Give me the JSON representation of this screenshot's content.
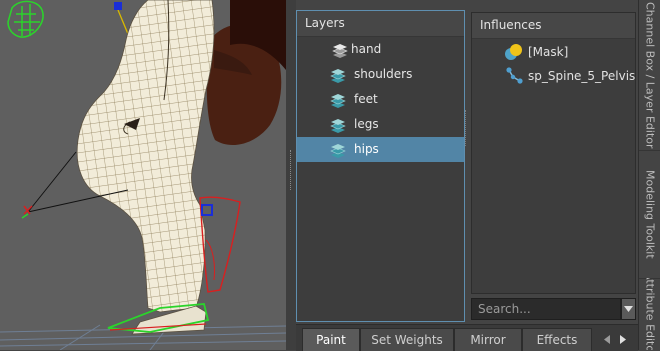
{
  "layers_panel": {
    "title": "Layers",
    "items": [
      {
        "label": "hand",
        "selected": false,
        "icon": "layer-stack-grey-icon"
      },
      {
        "label": "shoulders",
        "selected": false,
        "icon": "layer-stack-teal-icon"
      },
      {
        "label": "feet",
        "selected": false,
        "icon": "layer-stack-teal-icon"
      },
      {
        "label": "legs",
        "selected": false,
        "icon": "layer-stack-teal-icon"
      },
      {
        "label": "hips",
        "selected": true,
        "icon": "layer-stack-teal-icon"
      }
    ]
  },
  "influences_panel": {
    "title": "Influences",
    "items": [
      {
        "label": "[Mask]",
        "icon": "mask-icon"
      },
      {
        "label": "sp_Spine_5_Pelvis",
        "icon": "joint-icon"
      }
    ],
    "search_placeholder": "Search..."
  },
  "tabs": [
    {
      "label": "Paint",
      "active": true
    },
    {
      "label": "Set Weights",
      "active": false
    },
    {
      "label": "Mirror",
      "active": false
    },
    {
      "label": "Effects",
      "active": false
    }
  ],
  "side_dock": {
    "tabs": [
      "Channel Box / Layer Editor",
      "Modeling Toolkit",
      "Attribute Editor"
    ]
  },
  "colors": {
    "selection": "#5285a6",
    "panel_border_active": "#5f8fb0",
    "viewport_bg": "#5f5f5f",
    "mesh_fill": "#f2ecd9",
    "wire_yellow": "#d8b800",
    "ik_green": "#2bd42b",
    "ik_red": "#d82020",
    "hair_brown": "#4a2012"
  }
}
